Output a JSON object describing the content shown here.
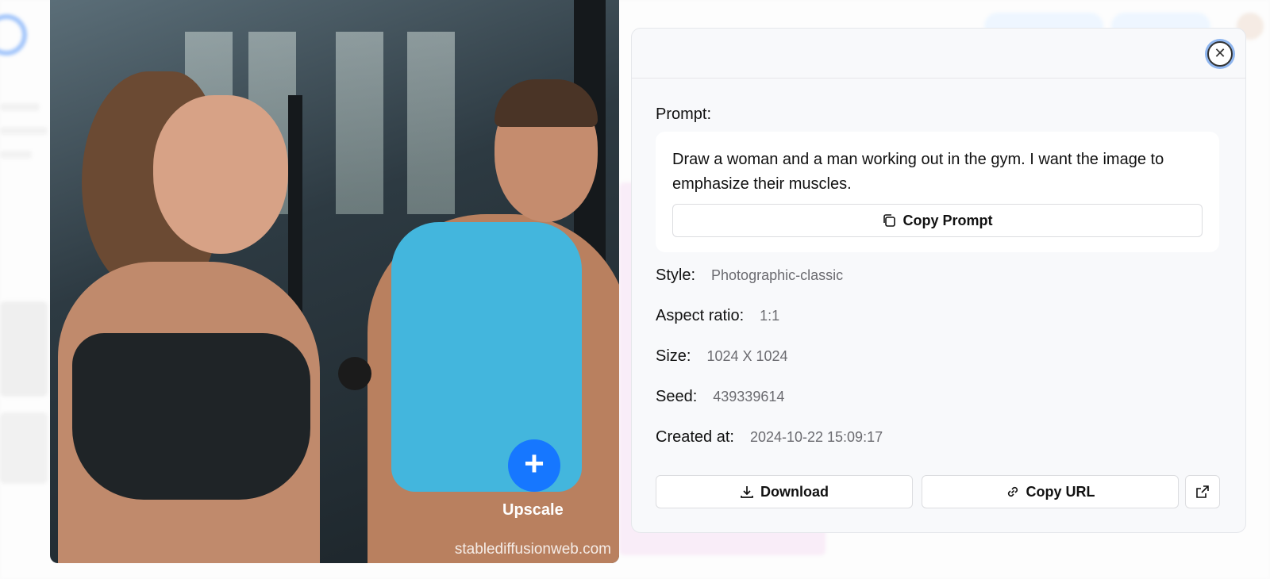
{
  "modal": {
    "prompt_label": "Prompt:",
    "prompt_text": "Draw a woman and a man working out in the gym. I want the image to emphasize their muscles.",
    "copy_prompt_label": "Copy Prompt",
    "meta": [
      {
        "key": "Style:",
        "value": "Photographic-classic"
      },
      {
        "key": "Aspect ratio:",
        "value": "1:1"
      },
      {
        "key": "Size:",
        "value": "1024 X 1024"
      },
      {
        "key": "Seed:",
        "value": "439339614"
      },
      {
        "key": "Created at:",
        "value": "2024-10-22 15:09:17"
      }
    ],
    "download_label": "Download",
    "copy_url_label": "Copy URL"
  },
  "image": {
    "upscale_label": "Upscale",
    "watermark": "stablediffusionweb.com"
  },
  "colors": {
    "accent": "#1677ff",
    "panel_bg": "#f8f9fb"
  },
  "icons": {
    "close": "close-icon",
    "copy": "copy-icon",
    "download": "download-icon",
    "link": "link-icon",
    "external": "external-link-icon",
    "plus": "plus-icon"
  }
}
